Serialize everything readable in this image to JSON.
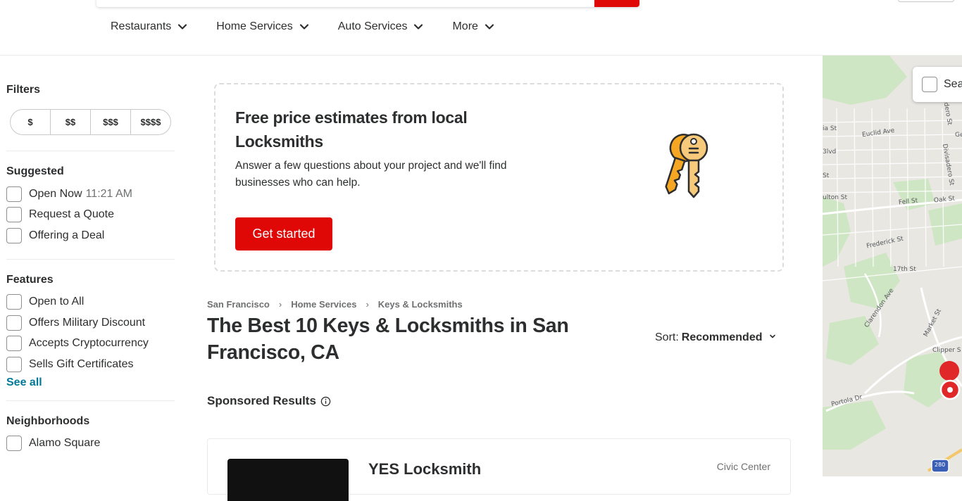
{
  "nav": {
    "categories": [
      {
        "label": "Restaurants"
      },
      {
        "label": "Home Services"
      },
      {
        "label": "Auto Services"
      },
      {
        "label": "More"
      }
    ]
  },
  "sidebar": {
    "filters_title": "Filters",
    "price_options": [
      "$",
      "$$",
      "$$$",
      "$$$$"
    ],
    "suggested": {
      "title": "Suggested",
      "items": [
        {
          "label": "Open Now",
          "sub": "11:21 AM"
        },
        {
          "label": "Request a Quote"
        },
        {
          "label": "Offering a Deal"
        }
      ]
    },
    "features": {
      "title": "Features",
      "items": [
        {
          "label": "Open to All"
        },
        {
          "label": "Offers Military Discount"
        },
        {
          "label": "Accepts Cryptocurrency"
        },
        {
          "label": "Sells Gift Certificates"
        }
      ],
      "see_all": "See all"
    },
    "neighborhoods": {
      "title": "Neighborhoods",
      "items": [
        {
          "label": "Alamo Square"
        }
      ]
    }
  },
  "promo": {
    "title": "Free price estimates from local Locksmiths",
    "text": "Answer a few questions about your project and we'll find businesses who can help.",
    "button": "Get started",
    "icon": "keys-illustration"
  },
  "breadcrumb": [
    "San Francisco",
    "Home Services",
    "Keys & Locksmiths"
  ],
  "page_title": "The Best 10 Keys & Locksmiths in San Francisco, CA",
  "sort": {
    "label": "Sort:",
    "value": "Recommended"
  },
  "sponsored_label": "Sponsored Results",
  "results": [
    {
      "name": "YES Locksmith",
      "neighborhood": "Civic Center"
    }
  ],
  "map": {
    "search_label": "Sea",
    "street_labels": [
      "ia St",
      "Euclid Ave",
      "adero St",
      "Ge",
      "Divisadero St",
      "3lvd",
      "St",
      "ulton St",
      "Fell St",
      "Oak St",
      "Frederick St",
      "17th St",
      "Clarendon Ave",
      "Market St",
      "Clipper S",
      "Portola Dr",
      "280"
    ]
  },
  "colors": {
    "brand_red": "#e00707",
    "link_teal": "#027a97",
    "text": "#2d2e2f",
    "muted": "#6e7072"
  }
}
